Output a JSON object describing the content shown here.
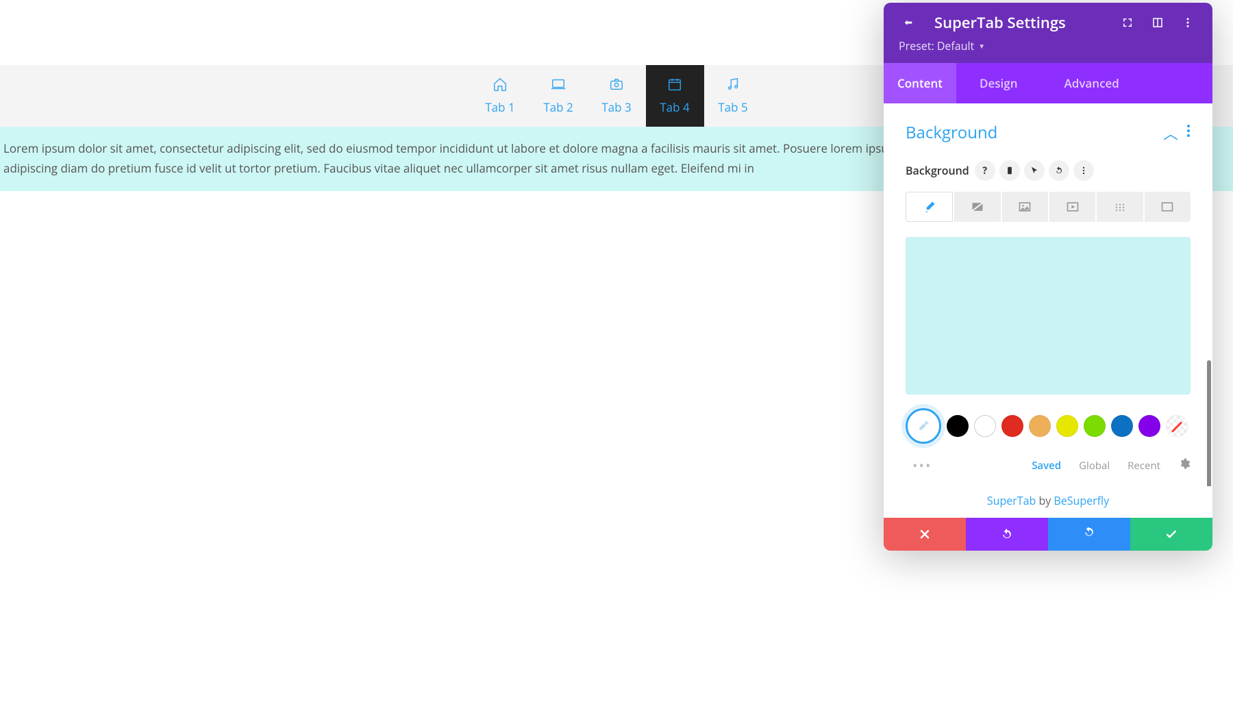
{
  "preview": {
    "tabs": [
      {
        "label": "Tab 1",
        "icon": "home"
      },
      {
        "label": "Tab 2",
        "icon": "laptop"
      },
      {
        "label": "Tab 3",
        "icon": "camera"
      },
      {
        "label": "Tab 4",
        "icon": "calendar"
      },
      {
        "label": "Tab 5",
        "icon": "music"
      }
    ],
    "active_tab_index": 3,
    "active_tab_content": "Lorem ipsum dolor sit amet, consectetur adipiscing elit, sed do eiusmod tempor incididunt ut labore et dolore magna a facilisis mauris sit amet. Posuere lorem ipsum dolor sit amet consectetur adipiscing elit. Aenean sed adipiscing diam do pretium fusce id velit ut tortor pretium. Faucibus vitae aliquet nec ullamcorper sit amet risus nullam eget. Eleifend mi in",
    "highlight_color": "#cdf7f4"
  },
  "panel": {
    "title": "SuperTab Settings",
    "preset_label": "Preset: Default",
    "tabs": {
      "content": "Content",
      "design": "Design",
      "advanced": "Advanced"
    },
    "active_tab": "content",
    "section": {
      "title": "Background",
      "field_label": "Background",
      "bg_types": [
        "color",
        "gradient",
        "image",
        "video",
        "pattern",
        "mask"
      ],
      "active_bg_type_index": 0,
      "current_color": "#c9f3f4",
      "swatches": [
        "eyedrop",
        "#000000",
        "#ffffff",
        "#e02b20",
        "#edb059",
        "#e6e600",
        "#7cdb00",
        "#0c71c3",
        "#8300e9",
        "none"
      ],
      "palette_tabs": {
        "saved": "Saved",
        "global": "Global",
        "recent": "Recent"
      },
      "active_palette_tab": "saved"
    },
    "credit": {
      "product": "SuperTab",
      "by": " by ",
      "author": "BeSuperfly"
    }
  }
}
